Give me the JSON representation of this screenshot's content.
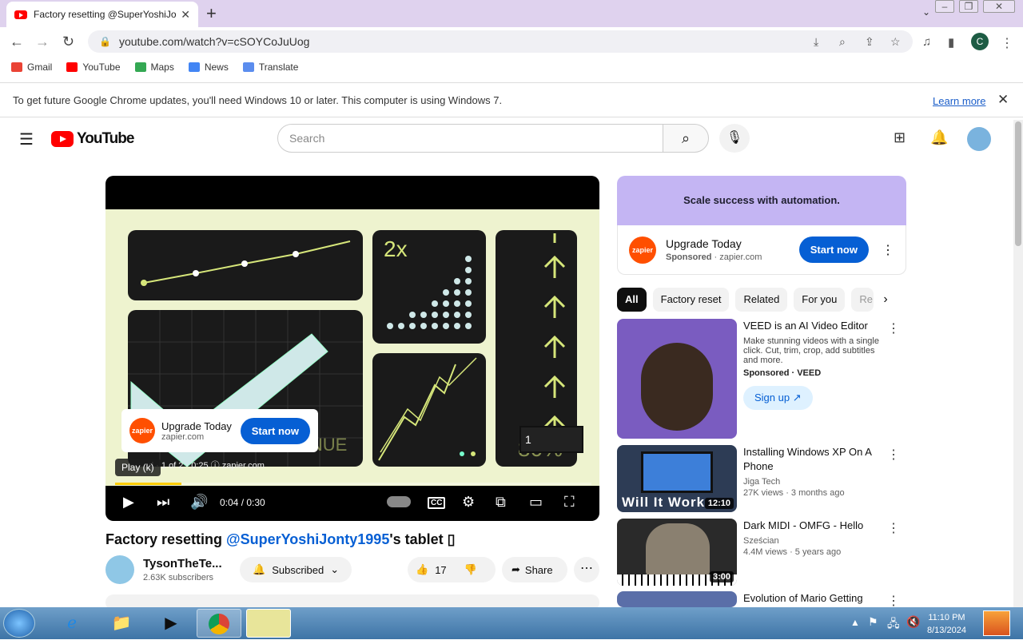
{
  "browser": {
    "tab_title": "Factory resetting @SuperYoshiJo",
    "url": "youtube.com/watch?v=cSOYCoJuUog",
    "profile_initial": "C",
    "bookmarks": [
      "Gmail",
      "YouTube",
      "Maps",
      "News",
      "Translate"
    ],
    "infobar_text": "To get future Google Chrome updates, you'll need Windows 10 or later. This computer is using Windows 7.",
    "infobar_link": "Learn more"
  },
  "youtube": {
    "logo_text": "YouTube",
    "search_placeholder": "Search"
  },
  "player": {
    "ad_overlay_title": "Upgrade Today",
    "ad_overlay_domain": "zapier.com",
    "ad_overlay_button": "Start now",
    "tooltip": "Play (k)",
    "ad_info": "d · 1 of 2 · 0:25 ⓘ   zapier.com",
    "time": "0:04 / 0:30",
    "progress_fraction": 0.14,
    "chart_label_2x": "2x",
    "revenue_label": "REVENUE",
    "skip_count": "1"
  },
  "video": {
    "title_prefix": "Factory resetting ",
    "title_mention": "@SuperYoshiJonty1995",
    "title_suffix": "'s tablet ▯",
    "channel_name": "TysonTheTe...",
    "subscribers": "2.63K subscribers",
    "subscribed_label": "Subscribed",
    "likes": "17",
    "share_label": "Share"
  },
  "sidebar": {
    "ad_banner_text": "Scale success with automation.",
    "ad_title": "Upgrade Today",
    "ad_sponsored": "Sponsored",
    "ad_domain": "· zapier.com",
    "ad_button": "Start now",
    "chips": [
      "All",
      "Factory reset",
      "Related",
      "For you",
      "Re"
    ],
    "videos": [
      {
        "title": "VEED is an AI Video Editor",
        "desc": "Make stunning videos with a single click. Cut, trim, crop, add subtitles and more.",
        "channel": "Sponsored · VEED",
        "action": "Sign up"
      },
      {
        "title": "Installing Windows XP On A Phone",
        "channel": "Jiga Tech",
        "meta": "27K views · 3 months ago",
        "duration": "12:10",
        "overlay": "Will It Work"
      },
      {
        "title": "Dark MIDI - OMFG - Hello",
        "channel": "Sześcian",
        "meta": "4.4M views · 5 years ago",
        "duration": "3:00"
      },
      {
        "title": "Evolution of Mario Getting"
      }
    ]
  },
  "taskbar": {
    "time": "11:10 PM",
    "date": "8/13/2024"
  },
  "colors": {
    "accent": "#065fd4",
    "brand": "#ff0000",
    "zapier": "#ff4f00",
    "tabbar": "#dfd2ee"
  }
}
